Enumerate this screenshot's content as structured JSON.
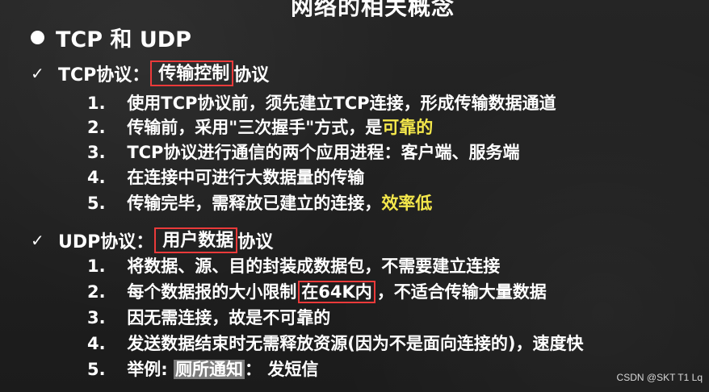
{
  "slide_title": "网络的相关概念",
  "heading": "TCP 和 UDP",
  "tcp": {
    "prefix": "TCP协议：",
    "boxed": "传输控制",
    "suffix": "协议",
    "items": [
      {
        "num": "1.",
        "text": "使用TCP协议前，须先建立TCP连接，形成传输数据通道"
      },
      {
        "num": "2.",
        "text": "传输前，采用\"三次握手\"方式，是",
        "highlight": "可靠的"
      },
      {
        "num": "3.",
        "text": "TCP协议进行通信的两个应用进程：客户端、服务端"
      },
      {
        "num": "4.",
        "text": "在连接中可进行大数据量的传输"
      },
      {
        "num": "5.",
        "text": "传输完毕，需释放已建立的连接，",
        "highlight": "效率低"
      }
    ]
  },
  "udp": {
    "prefix": "UDP协议：",
    "boxed": "用户数据",
    "suffix": "协议",
    "items": [
      {
        "num": "1.",
        "text": "将数据、源、目的封装成数据包，不需要建立连接"
      },
      {
        "num": "2.",
        "before": "每个数据报的大小限制",
        "boxed": "在64K内",
        "after": "，不适合传输大量数据"
      },
      {
        "num": "3.",
        "text": "因无需连接，故是不可靠的"
      },
      {
        "num": "4.",
        "text": "发送数据结束时无需释放资源(因为不是面向连接的)，速度快"
      },
      {
        "num": "5.",
        "before": "举例: ",
        "grey": "厕所通知",
        "after": "： 发短信"
      }
    ]
  },
  "watermark": "CSDN @SKT T1 Lq"
}
